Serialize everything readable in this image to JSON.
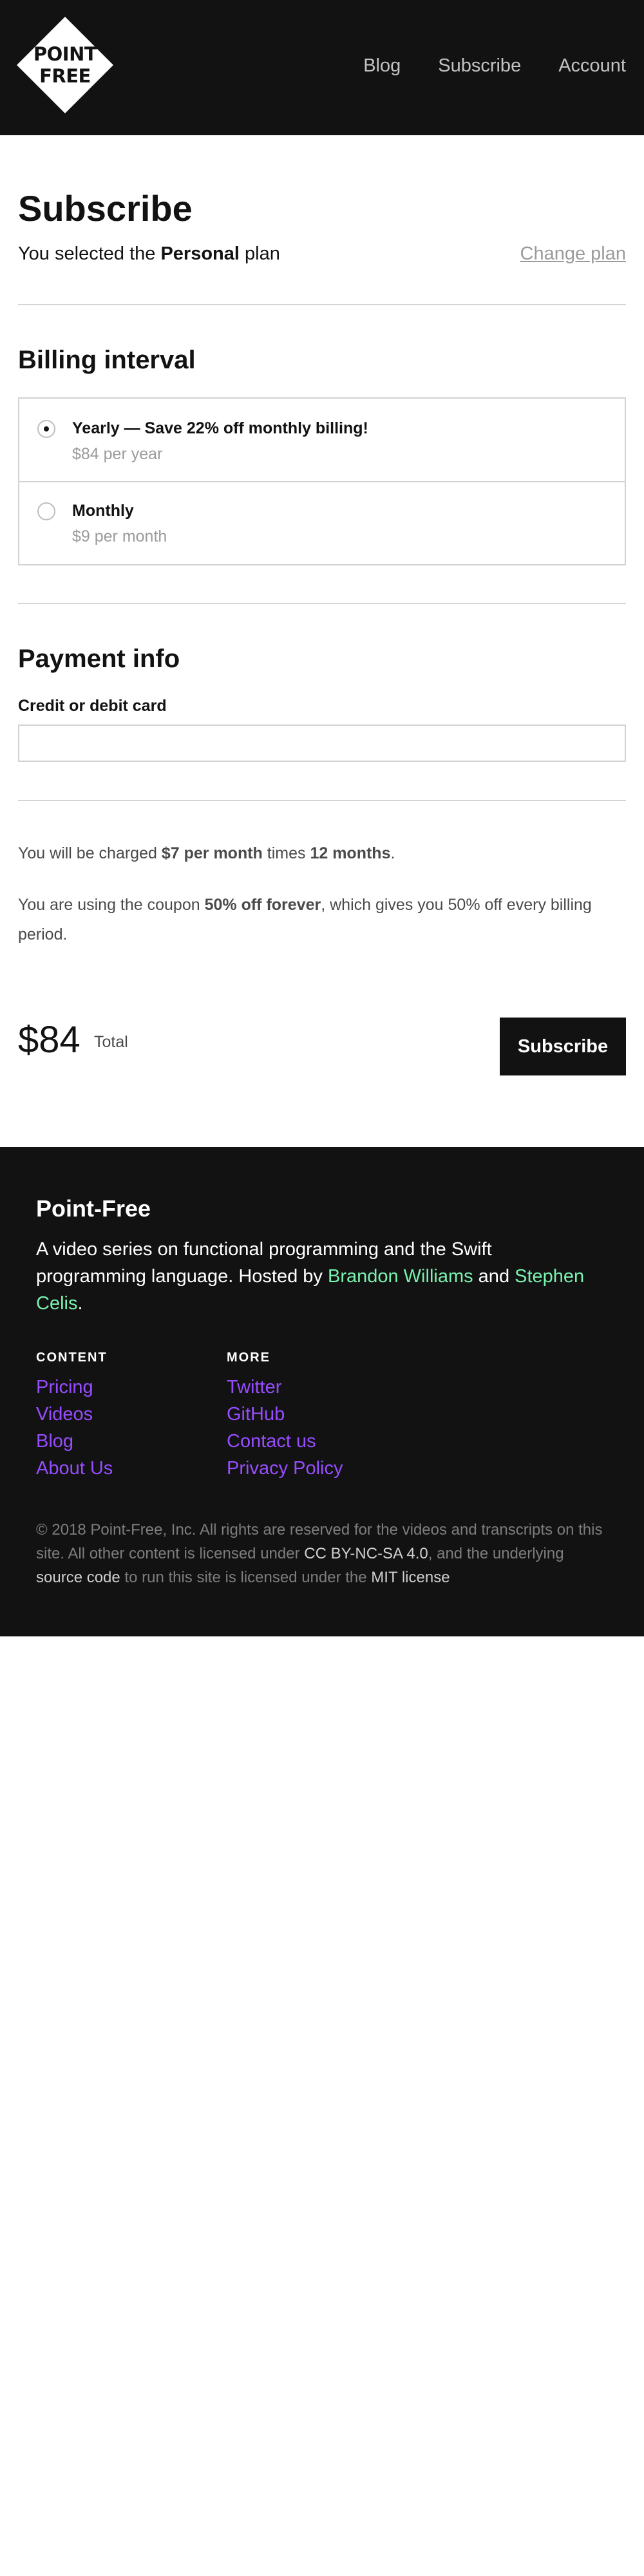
{
  "header": {
    "logo_line1": "POINT",
    "logo_line2": "FREE",
    "nav": [
      "Blog",
      "Subscribe",
      "Account"
    ]
  },
  "main": {
    "title": "Subscribe",
    "plan_prefix": "You selected the ",
    "plan_name": "Personal",
    "plan_suffix": " plan",
    "change_plan": "Change plan",
    "billing": {
      "title": "Billing interval",
      "options": [
        {
          "label": "Yearly — Save 22% off monthly billing!",
          "price": "$84 per year",
          "selected": true
        },
        {
          "label": "Monthly",
          "price": "$9 per month",
          "selected": false
        }
      ]
    },
    "payment": {
      "title": "Payment info",
      "card_label": "Credit or debit card",
      "card_value": ""
    },
    "charge": {
      "prefix": "You will be charged ",
      "amount": "$7 per month",
      "middle": " times ",
      "duration": "12 months",
      "suffix": "."
    },
    "coupon": {
      "prefix": "You are using the coupon ",
      "name": "50% off forever",
      "suffix": ", which gives you 50% off every billing period."
    },
    "total": {
      "amount": "$84",
      "label": "Total"
    },
    "subscribe_button": "Subscribe"
  },
  "footer": {
    "title": "Point-Free",
    "desc_prefix": "A video series on functional programming and the Swift programming language. Hosted by ",
    "host1": "Brandon Williams",
    "desc_and": " and ",
    "host2": "Stephen Celis",
    "desc_end": ".",
    "content_title": "CONTENT",
    "content_links": [
      "Pricing",
      "Videos",
      "Blog",
      "About Us"
    ],
    "more_title": "MORE",
    "more_links": [
      "Twitter",
      "GitHub",
      "Contact us",
      "Privacy Policy"
    ],
    "legal_1": "© 2018 Point-Free, Inc. All rights are reserved for the videos and transcripts on this site. All other content is licensed under ",
    "legal_link1": "CC BY-NC-SA 4.0",
    "legal_2": ", and the underlying ",
    "legal_link2": "source code",
    "legal_3": " to run this site is licensed under the ",
    "legal_link3": "MIT license"
  }
}
